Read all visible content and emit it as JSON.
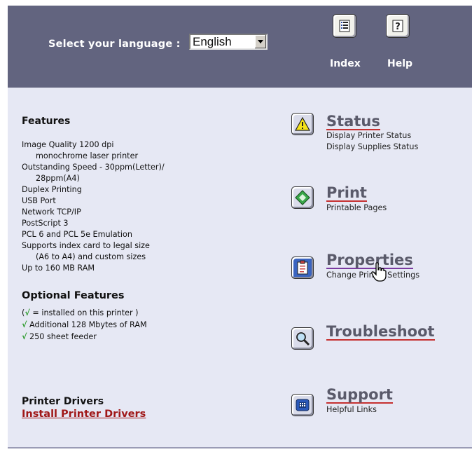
{
  "header": {
    "language_label": "Select your language :",
    "language_value": "English",
    "buttons": [
      {
        "label": "Index",
        "icon": "index-icon"
      },
      {
        "label": "Help",
        "icon": "help-icon"
      }
    ]
  },
  "features": {
    "title": "Features",
    "items": [
      {
        "text": "Image Quality 1200 dpi"
      },
      {
        "text": "monochrome laser printer",
        "indent": true
      },
      {
        "text": "Outstanding Speed - 30ppm(Letter)/"
      },
      {
        "text": "28ppm(A4)",
        "indent": true
      },
      {
        "text": "Duplex Printing"
      },
      {
        "text": "USB Port"
      },
      {
        "text": "Network TCP/IP"
      },
      {
        "text": "PostScript 3"
      },
      {
        "text": "PCL 6 and PCL 5e Emulation"
      },
      {
        "text": "Supports index card to legal size"
      },
      {
        "text": "(A6 to A4) and custom sizes",
        "indent": true
      },
      {
        "text": "Up to 160 MB RAM"
      }
    ]
  },
  "optional": {
    "title": "Optional Features",
    "legend_check": "√",
    "legend_text": " = installed on this printer )",
    "legend_open": "(",
    "items": [
      {
        "check": "√",
        "text": "Additional 128 Mbytes of RAM"
      },
      {
        "check": "√",
        "text": "250 sheet feeder"
      }
    ]
  },
  "drivers": {
    "title": "Printer Drivers",
    "link": "Install Printer Drivers"
  },
  "nav": {
    "status": {
      "title": "Status",
      "sub1": "Display Printer Status",
      "sub2": "Display Supplies Status",
      "icon": "warning-icon"
    },
    "print": {
      "title": "Print",
      "sub1": "Printable Pages",
      "icon": "print-diamond-icon"
    },
    "properties": {
      "title": "Properties",
      "sub1": "Change Printer Settings",
      "icon": "properties-clipboard-icon"
    },
    "troubleshoot": {
      "title": "Troubleshoot",
      "icon": "magnifier-icon"
    },
    "support": {
      "title": "Support",
      "sub1": "Helpful Links",
      "icon": "telephone-icon"
    }
  },
  "colors": {
    "header_bg": "#62647f",
    "page_bg": "#e6e8f4",
    "link_red": "#a01818",
    "underline_red": "#c63030",
    "check_green": "#2a9a2a"
  }
}
